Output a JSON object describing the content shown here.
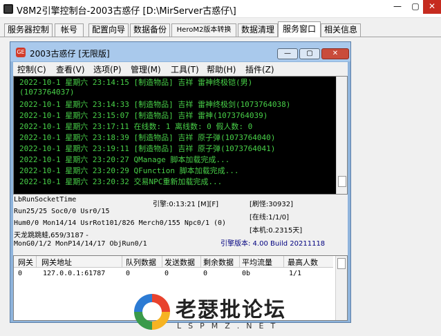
{
  "window": {
    "title": "V8M2引擎控制台-2003古惑仔 [D:\\MirServer古惑仔\\]",
    "controls": {
      "minimize": "—",
      "maximize": "▢",
      "close": "✕"
    }
  },
  "tabs": [
    {
      "label": "服务器控制"
    },
    {
      "label": "帐号"
    },
    {
      "label": "配置向导"
    },
    {
      "label": "数据备份"
    },
    {
      "label": "HeroM2版本转换"
    },
    {
      "label": "数据清理"
    },
    {
      "label": "服务窗口",
      "active": true
    },
    {
      "label": "相关信息"
    }
  ],
  "inner": {
    "title": "2003古惑仔 [无限版]",
    "icon_text": "GE",
    "menus": [
      {
        "label": "控制(C)"
      },
      {
        "label": "查看(V)"
      },
      {
        "label": "选项(P)"
      },
      {
        "label": "管理(M)"
      },
      {
        "label": "工具(T)"
      },
      {
        "label": "帮助(H)"
      },
      {
        "label": "插件(Z)"
      }
    ],
    "log": [
      "2022-10-1 星期六 23:14:15 [制造物品] 吉祥 雷神终极铠(男)",
      "(1073764037)",
      "2022-10-1 星期六 23:14:33 [制造物品] 吉祥 雷神终极剑(1073764038)",
      "2022-10-1 星期六 23:15:07 [制造物品] 吉祥 雷神(1073764039)",
      "2022-10-1 星期六 23:17:11 在线数: 1 离线数: 0 假人数: 0",
      "2022-10-1 星期六 23:18:39 [制造物品] 吉祥 原子弹(1073764040)",
      "2022-10-1 星期六 23:19:11 [制造物品] 吉祥 原子弹(1073764041)",
      "2022-10-1 星期六 23:20:27 QManage 脚本加载完成...",
      "2022-10-1 星期六 23:20:29 QFunction 脚本加载完成...",
      "2022-10-1 星期六 23:20:32 交易NPC重新加载完成..."
    ],
    "status": {
      "lb_run": "LbRunSocketTime",
      "engine": "引擎:0:13:21 [M][F]",
      "refresh": "[刷怪:30932]",
      "run_line": "Run25/25 Soc0/0 Usr0/15",
      "online": "[在线:1/1/0]",
      "hum_line": "Hum0/0 Mon14/14 UsrRot101/826 Merch0/155 Npc0/1 (0)",
      "local": "[本机:0.2315天]",
      "player": "天龙跳跳蛙,659/3187 -",
      "mon_line": "MonG0/1/2 MonP14/14/17 ObjRun0/1",
      "version": "引擎版本: 4.00 Build 20211118"
    },
    "grid": {
      "headers": [
        "网关",
        "网关地址",
        "队列数据",
        "发送数据",
        "剩余数据",
        "平均流量",
        "最高人数"
      ],
      "rows": [
        [
          "0",
          "127.0.0.1:61787",
          "0",
          "0",
          "0",
          "0b",
          "1/1"
        ]
      ]
    }
  },
  "watermark": {
    "text": "老瑟批论坛",
    "sub": "LSPMZ.NET"
  }
}
